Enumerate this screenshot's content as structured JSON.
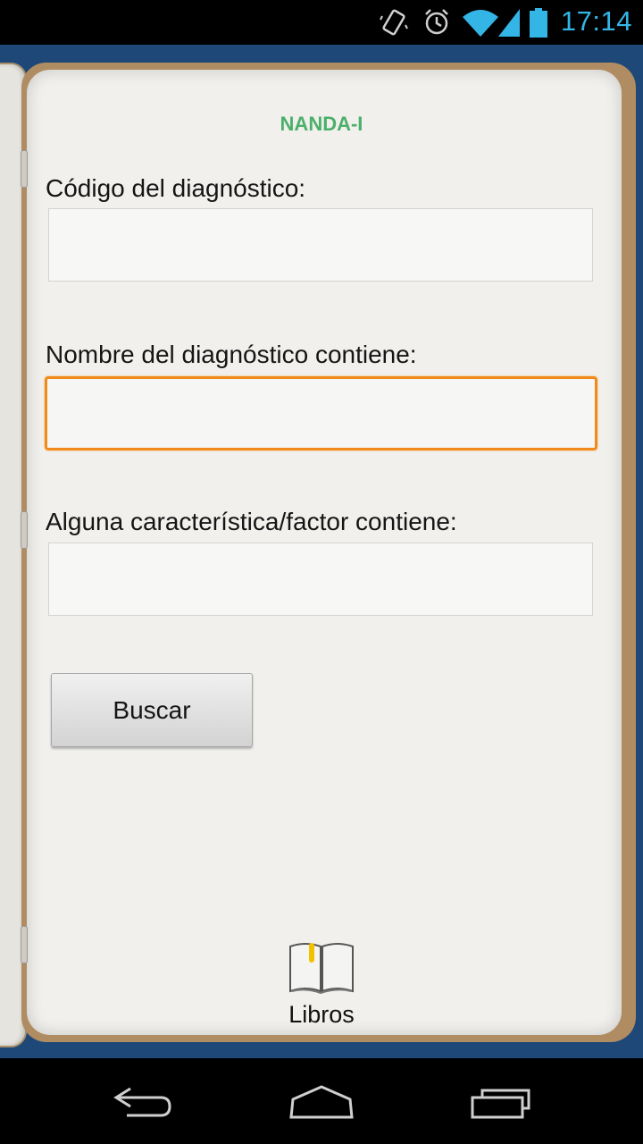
{
  "status_bar": {
    "time": "17:14",
    "accent_color": "#33b5e5",
    "icons": [
      "vibrate-icon",
      "alarm-icon",
      "wifi-icon",
      "signal-icon",
      "battery-icon"
    ]
  },
  "page": {
    "title": "NANDA-I",
    "title_color": "#4caf6a"
  },
  "form": {
    "code_label": "Código del diagnóstico:",
    "code_value": "",
    "name_label": "Nombre del diagnóstico contiene:",
    "name_value": "",
    "characteristic_label": "Alguna característica/factor contiene:",
    "characteristic_value": "",
    "search_button": "Buscar",
    "focus_color": "#f28a1b"
  },
  "footer": {
    "books_label": "Libros",
    "books_icon": "open-book-icon"
  },
  "navigation": {
    "buttons": [
      "back-icon",
      "home-icon",
      "recent-apps-icon"
    ]
  }
}
